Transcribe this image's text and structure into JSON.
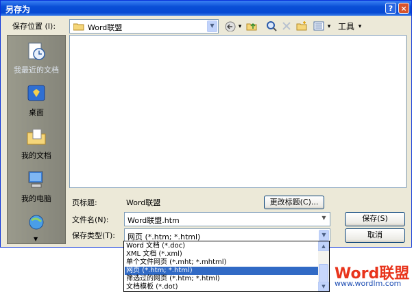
{
  "window": {
    "title": "另存为",
    "help_label": "?",
    "close_label": "×"
  },
  "location": {
    "label": "保存位置 (I):",
    "value": "Word联盟",
    "drop": "▼"
  },
  "toolbar": {
    "tools_label": "工具",
    "tools_drop": "▾",
    "views_drop": "▾",
    "back_drop": "▾"
  },
  "places": [
    {
      "name": "我最近的文档"
    },
    {
      "name": "桌面"
    },
    {
      "name": "我的文档"
    },
    {
      "name": "我的电脑"
    },
    {
      "name": ""
    }
  ],
  "page_title": {
    "label": "页标题:",
    "value": "Word联盟",
    "button": "更改标题(C)..."
  },
  "filename": {
    "label": "文件名(N):",
    "value": "Word联盟.htm"
  },
  "filetype": {
    "label": "保存类型(T):",
    "value": "网页 (*.htm; *.html)"
  },
  "buttons": {
    "save": "保存(S)",
    "cancel": "取消"
  },
  "dropdown_options": [
    "Word 文档 (*.doc)",
    "XML 文档 (*.xml)",
    "单个文件网页 (*.mht; *.mhtml)",
    "网页 (*.htm; *.html)",
    "筛选过的网页 (*.htm; *.html)",
    "文档模板 (*.dot)"
  ],
  "selected_option_index": 3,
  "watermark": {
    "brand": "Word联盟",
    "url": "www.wordlm.com"
  },
  "colors": {
    "titlebar": "#0a4fd6",
    "selection": "#316ac5",
    "watermark": "#e8341c"
  }
}
